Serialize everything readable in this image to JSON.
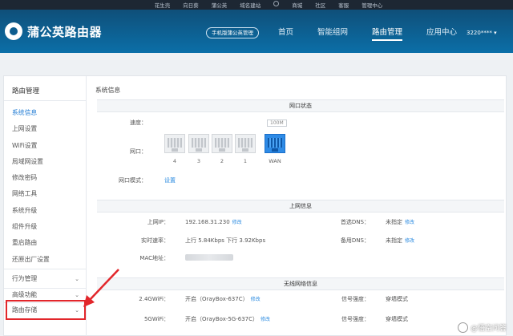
{
  "topbar": {
    "links": [
      "花生壳",
      "向日葵",
      "蒲公英",
      "域名建站",
      "商城",
      "社区",
      "客服",
      "管理中心"
    ]
  },
  "header": {
    "logo_text": "蒲公英路由器",
    "mobile_button": "手机版蒲公英管理",
    "nav": [
      "首页",
      "智能组网",
      "路由管理",
      "应用中心"
    ],
    "active_nav": 2,
    "user": "3220****"
  },
  "sidebar": {
    "title": "路由管理",
    "items": [
      "系统信息",
      "上网设置",
      "WiFi设置",
      "局域网设置",
      "修改密码",
      "网络工具",
      "系统升级",
      "组件升级",
      "重启路由",
      "还原出厂设置"
    ],
    "active_item": 0,
    "groups": [
      "行为管理",
      "高级功能",
      "路由存储"
    ]
  },
  "content": {
    "page_title": "系统信息",
    "port_status": {
      "heading": "网口状态",
      "speed_label": "速度：",
      "speed_tag": "100M",
      "port_label": "网口：",
      "ports": [
        "4",
        "3",
        "2",
        "1",
        "WAN"
      ],
      "mode_label": "网口模式：",
      "mode_link": "设置"
    },
    "internet": {
      "heading": "上网信息",
      "ip_label": "上网IP：",
      "ip_value": "192.168.31.230",
      "ip_link": "修改",
      "rate_label": "实时速率：",
      "rate_value": "上行 5.84Kbps  下行 3.92Kbps",
      "mac_label": "MAC地址：",
      "dns1_label": "首选DNS：",
      "dns1_value": "未指定",
      "dns1_link": "修改",
      "dns2_label": "备用DNS：",
      "dns2_value": "未指定",
      "dns2_link": "修改"
    },
    "wireless": {
      "heading": "无线网络信息",
      "wifi24_label": "2.4GWiFi：",
      "wifi24_value": "开启（OrayBox-637C）",
      "wifi24_link": "修改",
      "wifi5_label": "5GWiFi：",
      "wifi5_value": "开启（OrayBox-5G-637C）",
      "wifi5_link": "修改",
      "signal_label": "信号强度：",
      "signal_value": "穿墙模式"
    }
  },
  "watermark": "@悟空问答",
  "colors": {
    "header_top": "#0f4f79",
    "header_bottom": "#0b6fa8",
    "link": "#2b8be0",
    "wan_port": "#2e8be6",
    "highlight": "#e2262b"
  }
}
